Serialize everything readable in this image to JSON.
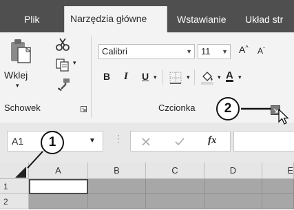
{
  "tabs": [
    {
      "label": "Plik",
      "active": false
    },
    {
      "label": "Narzędzia główne",
      "active": true
    },
    {
      "label": "Wstawianie",
      "active": false
    },
    {
      "label": "Układ str",
      "active": false
    }
  ],
  "clipboard": {
    "paste_label": "Wklej",
    "group_label": "Schowek",
    "icons": [
      "paste-icon",
      "cut-icon",
      "copy-icon",
      "format-painter-icon",
      "dialog-launcher-icon"
    ]
  },
  "font": {
    "name": "Calibri",
    "size": "11",
    "bold_label": "B",
    "italic_label": "I",
    "underline_label": "U",
    "font_color_label": "A",
    "group_label": "Czcionka"
  },
  "formula_bar": {
    "name_box": "A1",
    "fx_label": "fx"
  },
  "grid": {
    "columns": [
      "A",
      "B",
      "C",
      "D",
      "E"
    ],
    "rows": [
      "1",
      "2"
    ]
  },
  "callouts": [
    "1",
    "2"
  ],
  "colors": {
    "tab_bar": "#4f4f4f",
    "ribbon": "#f3f3f3",
    "selected_range": "#a7a7a7"
  }
}
